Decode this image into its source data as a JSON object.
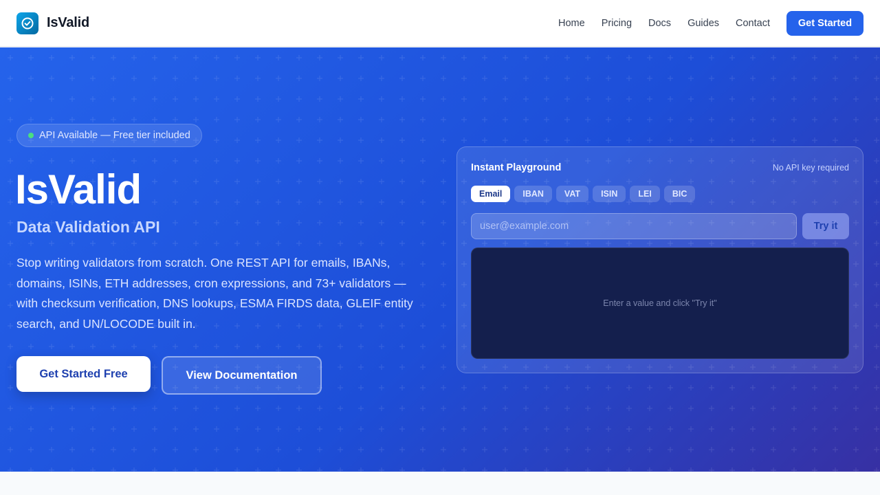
{
  "header": {
    "brand": "IsValid",
    "nav": [
      {
        "label": "Home"
      },
      {
        "label": "Pricing"
      },
      {
        "label": "Docs"
      },
      {
        "label": "Guides"
      },
      {
        "label": "Contact"
      }
    ],
    "cta_label": "Get Started"
  },
  "hero": {
    "badge": "API Available — Free tier included",
    "title": "IsValid",
    "subtitle": "Data Validation API",
    "description": "Stop writing validators from scratch. One REST API for emails, IBANs, domains, ISINs, ETH addresses, cron expressions, and 73+ validators — with checksum verification, DNS lookups, ESMA FIRDS data, GLEIF entity search, and UN/LOCODE built in.",
    "primary_button": "Get Started Free",
    "secondary_button": "View Documentation"
  },
  "playground": {
    "title": "Instant Playground",
    "note": "No API key required",
    "tabs": [
      {
        "label": "Email",
        "active": true
      },
      {
        "label": "IBAN",
        "active": false
      },
      {
        "label": "VAT",
        "active": false
      },
      {
        "label": "ISIN",
        "active": false
      },
      {
        "label": "LEI",
        "active": false
      },
      {
        "label": "BIC",
        "active": false
      }
    ],
    "input_placeholder": "user@example.com",
    "input_value": "",
    "try_button": "Try it",
    "output_hint": "Enter a value and click \"Try it\""
  },
  "colors": {
    "accent": "#2563eb",
    "status_dot": "#4ade80",
    "output_bg": "#141f4d"
  },
  "icons": {
    "logo": "check-circle-icon"
  }
}
